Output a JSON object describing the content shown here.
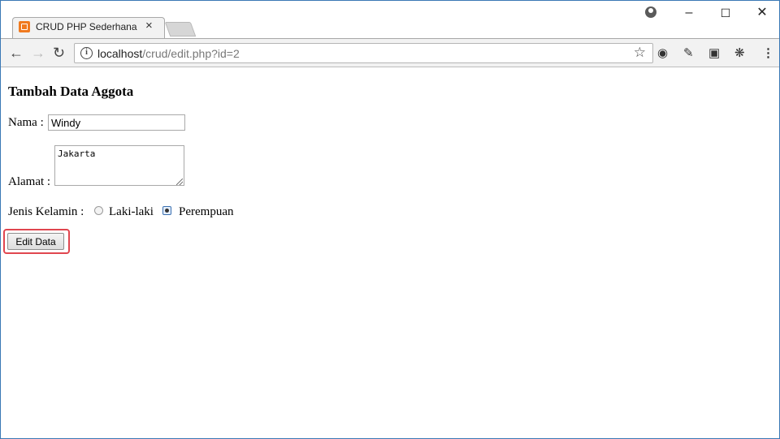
{
  "browser": {
    "tab_title": "CRUD PHP Sederhana",
    "tab_close": "×",
    "url_host": "localhost",
    "url_path": "/crud/edit.php?id=2",
    "window_controls": {
      "minimize": "–",
      "maximize": "☐",
      "close": "✕"
    }
  },
  "form": {
    "title": "Tambah Data Aggota",
    "nama_label": "Nama :",
    "nama_value": "Windy",
    "alamat_label": "Alamat :",
    "alamat_value": "Jakarta",
    "gender_label": "Jenis Kelamin :",
    "gender_options": [
      "Laki-laki",
      "Perempuan"
    ],
    "gender_selected": "Perempuan",
    "submit_label": "Edit Data"
  },
  "colors": {
    "highlight": "#e0464f",
    "window_border": "#3a78b5",
    "favicon": "#f07a1f"
  }
}
